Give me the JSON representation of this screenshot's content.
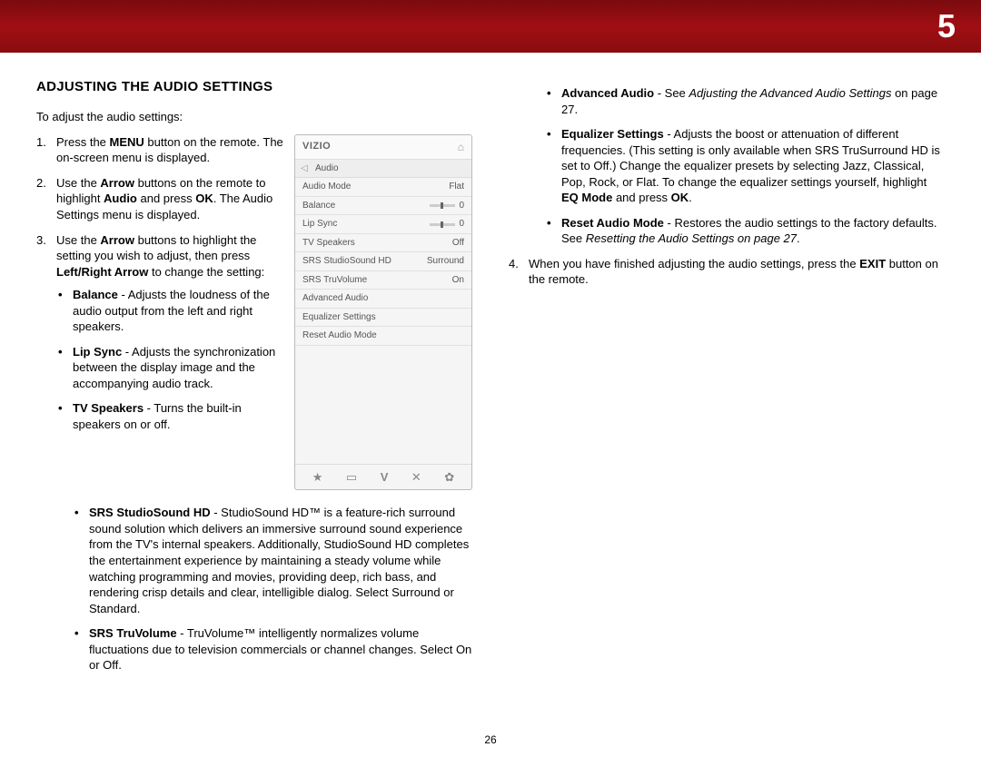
{
  "header": {
    "chapter": "5"
  },
  "page_number": "26",
  "left": {
    "title": "ADJUSTING THE AUDIO SETTINGS",
    "intro": "To adjust the audio settings:",
    "step1_a": "Press the ",
    "step1_menu": "MENU",
    "step1_b": " button on the remote. The on-screen menu is displayed.",
    "step2_a": "Use the ",
    "step2_arrow": "Arrow",
    "step2_b": " buttons on the remote to highlight ",
    "step2_audio": "Audio",
    "step2_c": " and press ",
    "step2_ok": "OK",
    "step2_d": ". The Audio Settings menu is displayed.",
    "step3_a": "Use the ",
    "step3_arrow": "Arrow",
    "step3_b": " buttons to highlight the setting you wish to adjust, then press ",
    "step3_lr": "Left/Right Arrow",
    "step3_c": " to change the setting:",
    "balance_t": "Balance",
    "balance_d": " - Adjusts the loudness of the audio output from the left and right speakers.",
    "lipsync_t": "Lip Sync",
    "lipsync_d": " - Adjusts the syn­chronization between the display image and the accompanying audio track.",
    "tvspk_t": "TV Speakers",
    "tvspk_d": " - Turns the built-in speakers on or off.",
    "srsss_t": "SRS StudioSound HD",
    "srsss_d": " - StudioSound HD™ is a feature-rich surround sound solution which delivers an immersive surround sound experience from the TV's internal speakers. Additionally, StudioSound HD completes the entertainment experience by maintaining a steady volume while watching programming and movies, providing deep, rich bass, and rendering crisp details and clear, intelligible dialog. Select Surround or Standard.",
    "srstv_t": "SRS TruVolume",
    "srstv_d": " - TruVolume™ intelligently normalizes volume fluctuations due to television commercials or channel changes. Select On or Off."
  },
  "right": {
    "adv_t": "Advanced Audio",
    "adv_a": " - See ",
    "adv_i": "Adjusting the Advanced Audio Settings",
    "adv_b": " on page 27.",
    "eq_t": "Equalizer Settings",
    "eq_a": " - Adjusts the boost or attenuation of different frequencies. (This setting is only available when SRS TruSurround HD is set to Off.) Change the equalizer presets by selecting Jazz, Classical, Pop, Rock, or Flat. To change the equalizer settings yourself, highlight ",
    "eq_mode": "EQ Mode",
    "eq_b": " and press ",
    "eq_ok": "OK",
    "eq_c": ".",
    "reset_t": "Reset Audio Mode",
    "reset_a": " - Restores the audio settings to the factory defaults. See ",
    "reset_i": "Resetting the Audio Settings on page 27",
    "reset_b": ".",
    "step4_a": "When you have finished adjusting the audio settings, press the ",
    "step4_exit": "EXIT",
    "step4_b": " button on the remote."
  },
  "menu": {
    "logo": "VIZIO",
    "breadcrumb": "Audio",
    "rows": {
      "audio_mode_l": "Audio Mode",
      "audio_mode_v": "Flat",
      "balance_l": "Balance",
      "balance_v": "0",
      "lipsync_l": "Lip Sync",
      "lipsync_v": "0",
      "tvspk_l": "TV Speakers",
      "tvspk_v": "Off",
      "srsss_l": "SRS StudioSound HD",
      "srsss_v": "Surround",
      "srstv_l": "SRS TruVolume",
      "srstv_v": "On",
      "adv_l": "Advanced Audio",
      "eq_l": "Equalizer Settings",
      "reset_l": "Reset Audio Mode"
    },
    "footer": {
      "star": "★",
      "tv": "⌧",
      "v": "V",
      "x": "✕",
      "gear": "✿"
    }
  }
}
